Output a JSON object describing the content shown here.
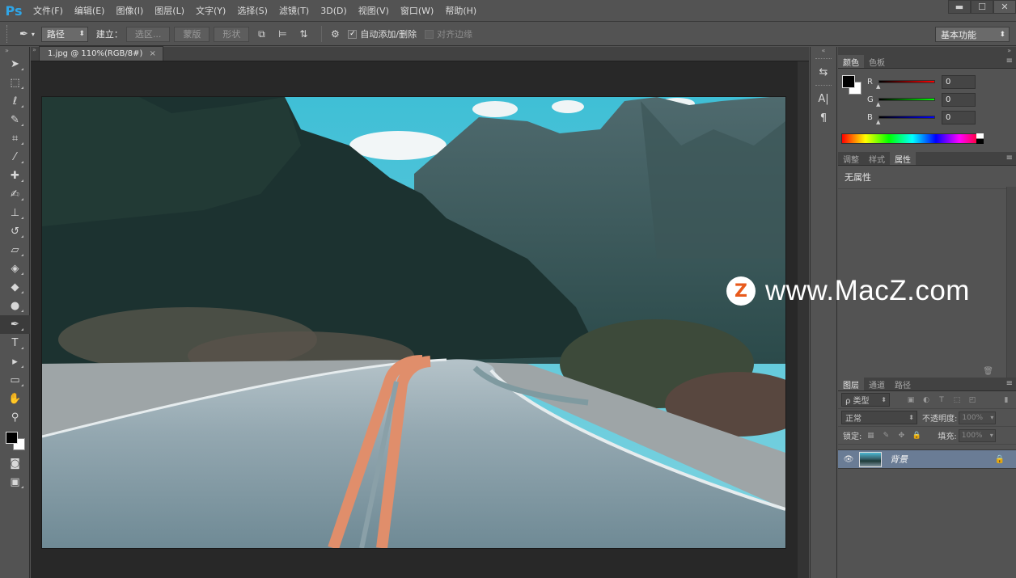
{
  "app": {
    "logo": "Ps",
    "menu": [
      "文件(F)",
      "编辑(E)",
      "图像(I)",
      "图层(L)",
      "文字(Y)",
      "选择(S)",
      "滤镜(T)",
      "3D(D)",
      "视图(V)",
      "窗口(W)",
      "帮助(H)"
    ],
    "window_controls": {
      "minimize": "▬",
      "maximize": "☐",
      "close": "✕"
    }
  },
  "options_bar": {
    "mode_select": "路径",
    "make_label": "建立：",
    "btn_selection": "选区...",
    "btn_mask": "蒙版",
    "btn_shape": "形状",
    "auto_add_delete": "自动添加/删除",
    "auto_add_delete_checked": true,
    "align_edges": "对齐边缘",
    "align_edges_checked": false,
    "workspace": "基本功能"
  },
  "document": {
    "tab_title": "1.jpg @ 110%(RGB/8#)",
    "tab_close": "×"
  },
  "color_panel": {
    "tabs": [
      "颜色",
      "色板"
    ],
    "active_tab": 0,
    "foreground": "#000000",
    "background": "#ffffff",
    "channels": [
      {
        "label": "R",
        "value": "0",
        "color": "#ff0000"
      },
      {
        "label": "G",
        "value": "0",
        "color": "#00ff00"
      },
      {
        "label": "B",
        "value": "0",
        "color": "#0000ff"
      }
    ]
  },
  "properties_panel": {
    "tabs": [
      "调整",
      "样式",
      "属性"
    ],
    "active_tab": 2,
    "content": "无属性"
  },
  "layers_panel": {
    "tabs": [
      "图层",
      "通道",
      "路径"
    ],
    "active_tab": 0,
    "filter": "ρ 类型",
    "blend_mode": "正常",
    "opacity_label": "不透明度:",
    "opacity_value": "100%",
    "lock_label": "锁定:",
    "fill_label": "填充:",
    "fill_value": "100%",
    "layers": [
      {
        "name": "背景",
        "visible": true,
        "locked": true
      }
    ]
  },
  "watermark": {
    "badge": "Z",
    "text": "www.MacZ.com"
  }
}
